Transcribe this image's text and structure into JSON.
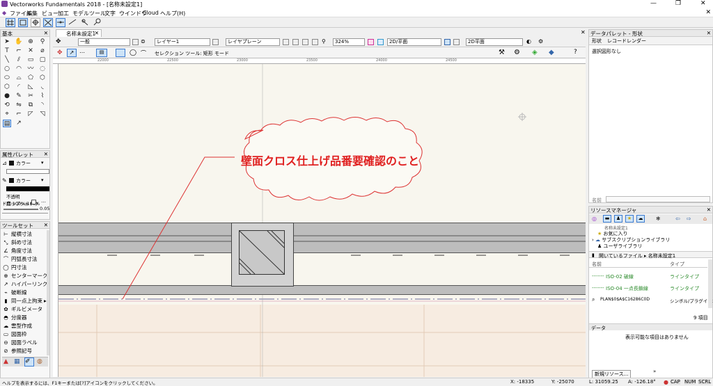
{
  "window": {
    "title": "Vectorworks Fundamentals 2018 - [名称未設定1]",
    "controls": [
      "—",
      "❐",
      "✕"
    ]
  },
  "menu": [
    "ファイル",
    "編集",
    "ビュー",
    "加工",
    "モデル",
    "ツール",
    "文字",
    "ウインドウ",
    "Cloud",
    "ヘルプ(H)"
  ],
  "panels": {
    "basic": {
      "title": "基本"
    },
    "attributes": {
      "title": "属性パレット",
      "fill_label": "カラー",
      "pen_label": "カラー",
      "opacity": "不透明度:100%/100%",
      "dropshadow": "ドロップシャドウ",
      "line_weight": "0.05"
    },
    "toolset": {
      "title": "ツールセット",
      "items": [
        "縦横寸法",
        "斜め寸法",
        "角度寸法",
        "円弧長寸法",
        "円寸法",
        "センターマーク",
        "ハイパーリンク",
        "破断線",
        "同一点上拘束",
        "ギルビメータ",
        "分度器",
        "雲型作成",
        "図面枠",
        "図面ラベル",
        "参照記号"
      ]
    }
  },
  "document": {
    "tab": "名称未設定1",
    "class_select": "一般",
    "layer_select": "レイヤー1",
    "layer_plane": "レイヤプレーン",
    "zoom": "324%",
    "view": "2D/平面",
    "view2": "2D平面",
    "mode_label": "セレクション ツール: 矩形 モード"
  },
  "canvas": {
    "annotation": "壁面クロス仕上げ品番要確認のこと",
    "annotation_color": "#e02020",
    "ruler_ticks": [
      "22000",
      "22500",
      "23000",
      "23500",
      "24000",
      "24500"
    ]
  },
  "datapalette": {
    "title": "データパレット - 形状",
    "tabs": [
      "形状",
      "レコード",
      "レンダー"
    ],
    "status": "選択図形なし",
    "name_label": "名前"
  },
  "resources": {
    "title": "リソースマネージャ",
    "tree": [
      "名称未設定1",
      "お気に入り",
      "サブスクリプションライブラリ",
      "ユーザライブラリ"
    ],
    "path": "開いているファイル ▸ 名称未設定1",
    "col_name": "名前",
    "col_type": "タイプ",
    "items": [
      {
        "name": "ISO-02 破線",
        "type": "ラインタイプ"
      },
      {
        "name": "ISO-04 一点長鎖線",
        "type": "ラインタイプ"
      },
      {
        "name": "PLAN$0$A$C16286C0D",
        "type": "シンボル/プラグインオブ"
      }
    ],
    "count": "9 項目",
    "data_header": "データ",
    "data_empty": "表示可能な項目はありません",
    "new_button": "新規リソース..."
  },
  "status": {
    "help": "ヘルプを表示するには、F1キーまたは[?]アイコンをクリックしてください。",
    "x": "X: -18335",
    "y": "Y: -25070",
    "l": "L: 31059.25",
    "a": "A: -126.18°",
    "flags": [
      "CAP",
      "NUM",
      "SCRL"
    ]
  }
}
